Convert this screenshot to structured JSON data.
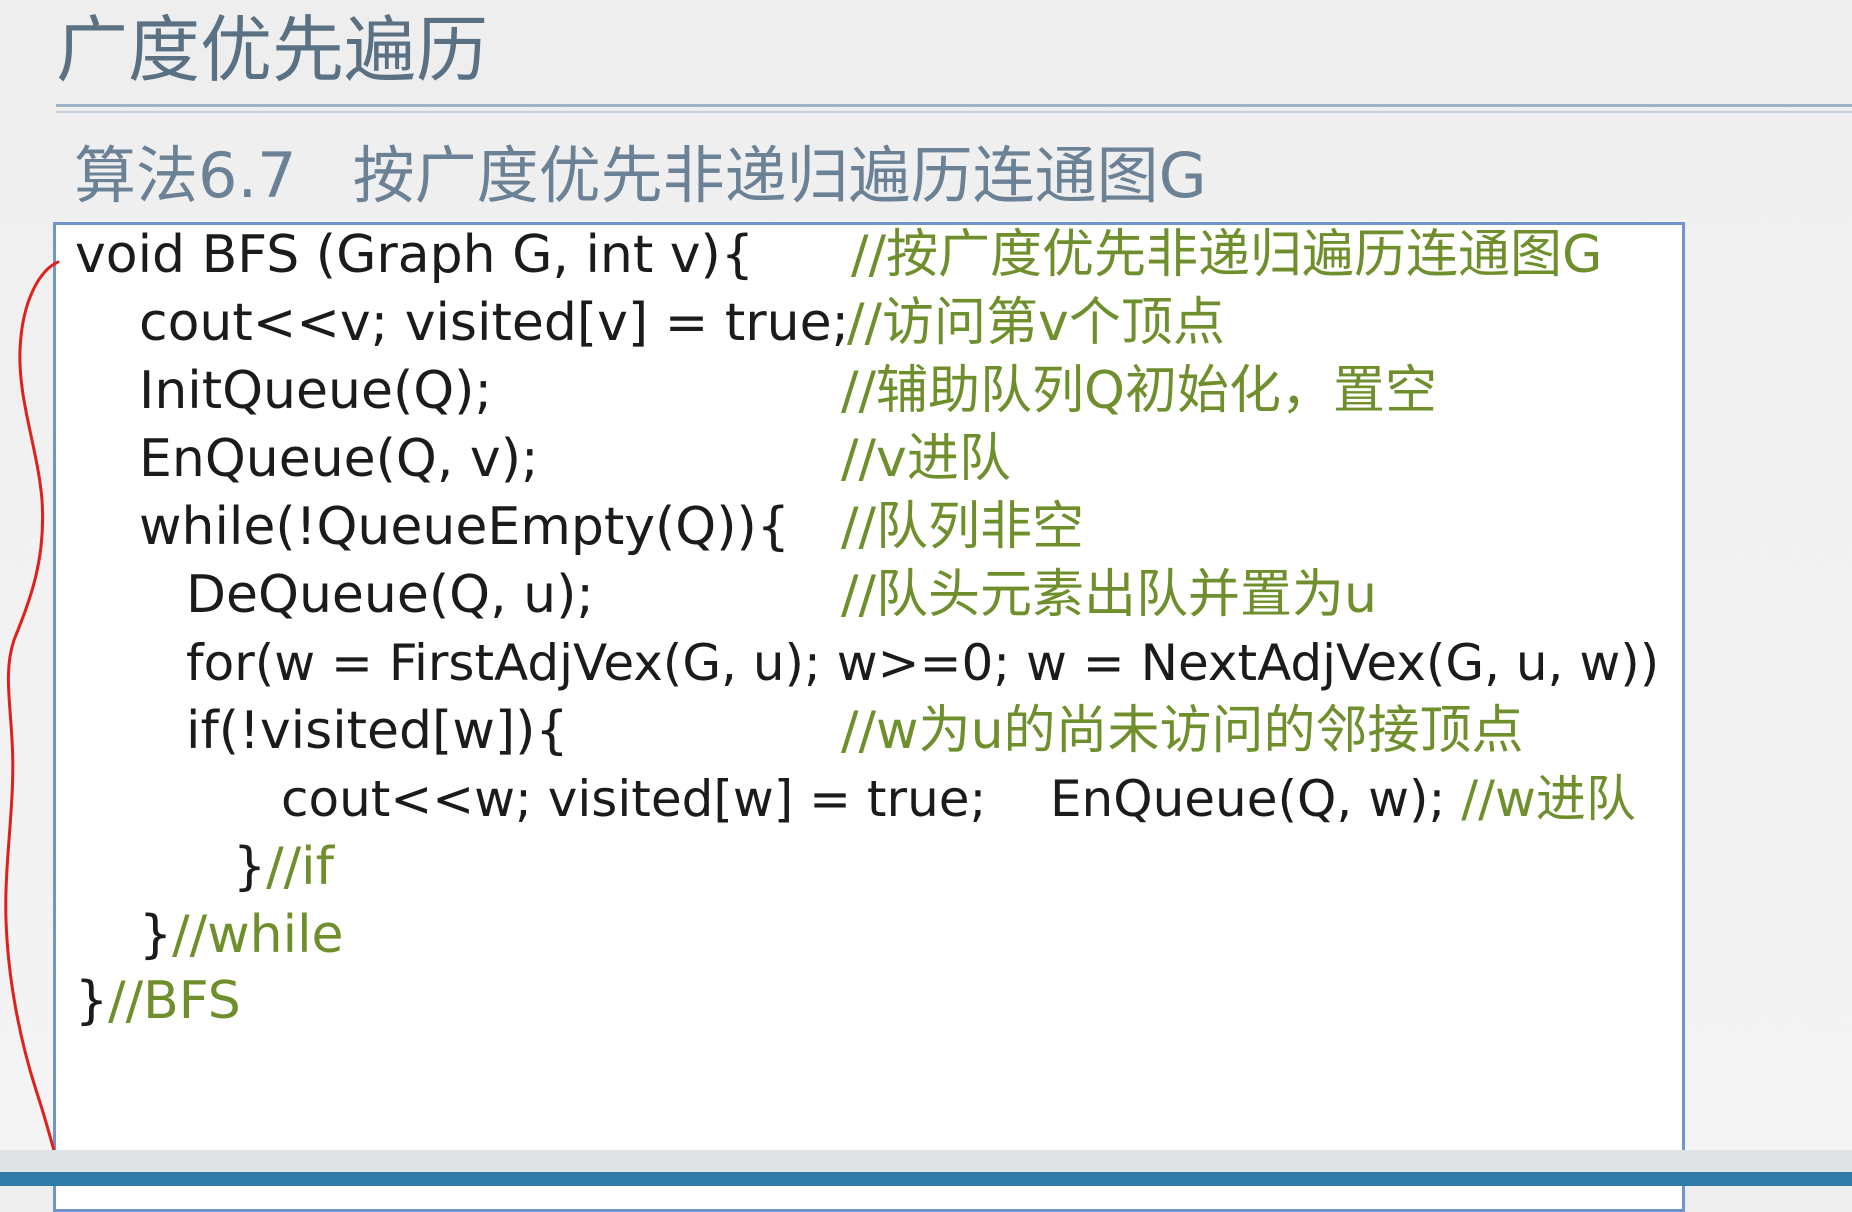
{
  "slide_title": "广度优先遍历",
  "algorithm": {
    "number": "算法6.7",
    "name": "按广度优先非递归遍历连通图G"
  },
  "code": {
    "line1": "void BFS (Graph G, int v){",
    "line1_comment": "//按广度优先非递归遍历连通图G",
    "line2": "cout<<v; visited[v] = true;",
    "line2_comment": "//访问第v个顶点",
    "line3": "InitQueue(Q);",
    "line3_comment": "//辅助队列Q初始化，置空",
    "line4": "EnQueue(Q, v);",
    "line4_comment": "//v进队",
    "line5": "while(!QueueEmpty(Q)){",
    "line5_comment": "//队列非空",
    "line6": "DeQueue(Q, u);",
    "line6_comment": "//队头元素出队并置为u",
    "line7": "for(w = FirstAdjVex(G, u); w>=0; w = NextAdjVex(G, u, w))",
    "line8": "if(!visited[w]){",
    "line8_comment": "//w为u的尚未访问的邻接顶点",
    "line9": "cout<<w; visited[w] = true;    EnQueue(Q, w); ",
    "line9_comment": "//w进队",
    "line10_brace": "}",
    "line10_comment": "//if",
    "line11_brace": "}",
    "line11_comment": "//while",
    "line12_brace": "}",
    "line12_comment": "//BFS"
  },
  "colors": {
    "title": "#5a7184",
    "algo_title": "#6b8195",
    "code_text": "#1b1b1b",
    "comment": "#6f8f2c",
    "box_border": "#6f95cc",
    "annotation": "#e0201a"
  }
}
